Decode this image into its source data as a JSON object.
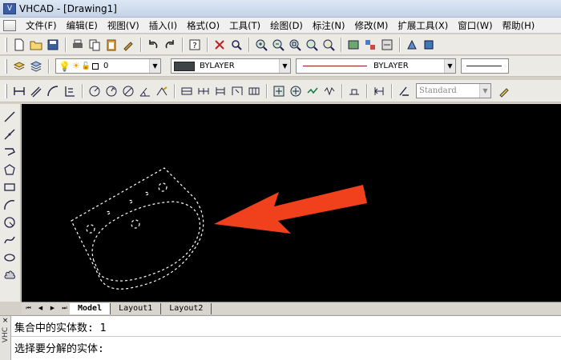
{
  "window": {
    "title": "VHCAD - [Drawing1]"
  },
  "menu": [
    "文件(F)",
    "编辑(E)",
    "视图(V)",
    "插入(I)",
    "格式(O)",
    "工具(T)",
    "绘图(D)",
    "标注(N)",
    "修改(M)",
    "扩展工具(X)",
    "窗口(W)",
    "帮助(H)"
  ],
  "layer": {
    "current": "0"
  },
  "properties": {
    "color_label": "BYLAYER",
    "linetype_label": "BYLAYER",
    "color_swatch": "#3e4446",
    "text_style": "Standard"
  },
  "layout_tabs": [
    "Model",
    "Layout1",
    "Layout2"
  ],
  "command": {
    "line1": "集合中的实体数: 1",
    "line2": "选择要分解的实体:",
    "panel_label": "VHC"
  },
  "colors": {
    "arrow": "#f0401c",
    "drawing_stroke": "#ffffff",
    "canvas_bg": "#000000"
  }
}
